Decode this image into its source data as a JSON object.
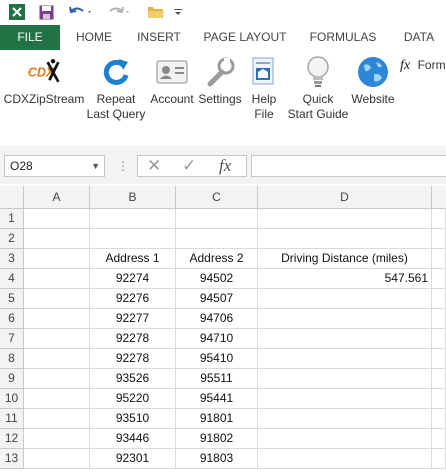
{
  "qat": {
    "icons": [
      "excel-logo-icon",
      "save-icon",
      "undo-icon",
      "redo-icon",
      "open-folder-icon",
      "customize-qat-icon"
    ]
  },
  "tabs": [
    "FILE",
    "HOME",
    "INSERT",
    "PAGE LAYOUT",
    "FORMULAS",
    "DATA"
  ],
  "ribbon": {
    "logo_text": "CDX",
    "buttons": [
      {
        "line1": "CDXZipStream",
        "line2": ""
      },
      {
        "line1": "Repeat",
        "line2": "Last Query"
      },
      {
        "line1": "Account",
        "line2": ""
      },
      {
        "line1": "Settings",
        "line2": ""
      },
      {
        "line1": "Help",
        "line2": "File"
      },
      {
        "line1": "Quick",
        "line2": "Start Guide"
      },
      {
        "line1": "Website",
        "line2": ""
      }
    ],
    "formula_group_label": "Form",
    "formula_group_symbol": "fx"
  },
  "formula_bar": {
    "name_box": "O28",
    "dots": "⋮",
    "cancel_symbol": "✕",
    "enter_symbol": "✓",
    "fx_symbol": "fx",
    "value": ""
  },
  "grid": {
    "columns": [
      "A",
      "B",
      "C",
      "D"
    ],
    "rows": [
      "1",
      "2",
      "3",
      "4",
      "5",
      "6",
      "7",
      "8",
      "9",
      "10",
      "11",
      "12",
      "13"
    ],
    "headers": {
      "b": "Address 1",
      "c": "Address 2",
      "d": "Driving Distance (miles)"
    },
    "data": [
      {
        "b": "92274",
        "c": "94502",
        "d": "547.561"
      },
      {
        "b": "92276",
        "c": "94507",
        "d": ""
      },
      {
        "b": "92277",
        "c": "94706",
        "d": ""
      },
      {
        "b": "92278",
        "c": "94710",
        "d": ""
      },
      {
        "b": "92278",
        "c": "95410",
        "d": ""
      },
      {
        "b": "93526",
        "c": "95511",
        "d": ""
      },
      {
        "b": "95220",
        "c": "95441",
        "d": ""
      },
      {
        "b": "93510",
        "c": "91801",
        "d": ""
      },
      {
        "b": "93446",
        "c": "91802",
        "d": ""
      },
      {
        "b": "92301",
        "c": "91803",
        "d": ""
      }
    ]
  },
  "colors": {
    "file_tab": "#217346",
    "accent_blue": "#1e7fd0"
  }
}
